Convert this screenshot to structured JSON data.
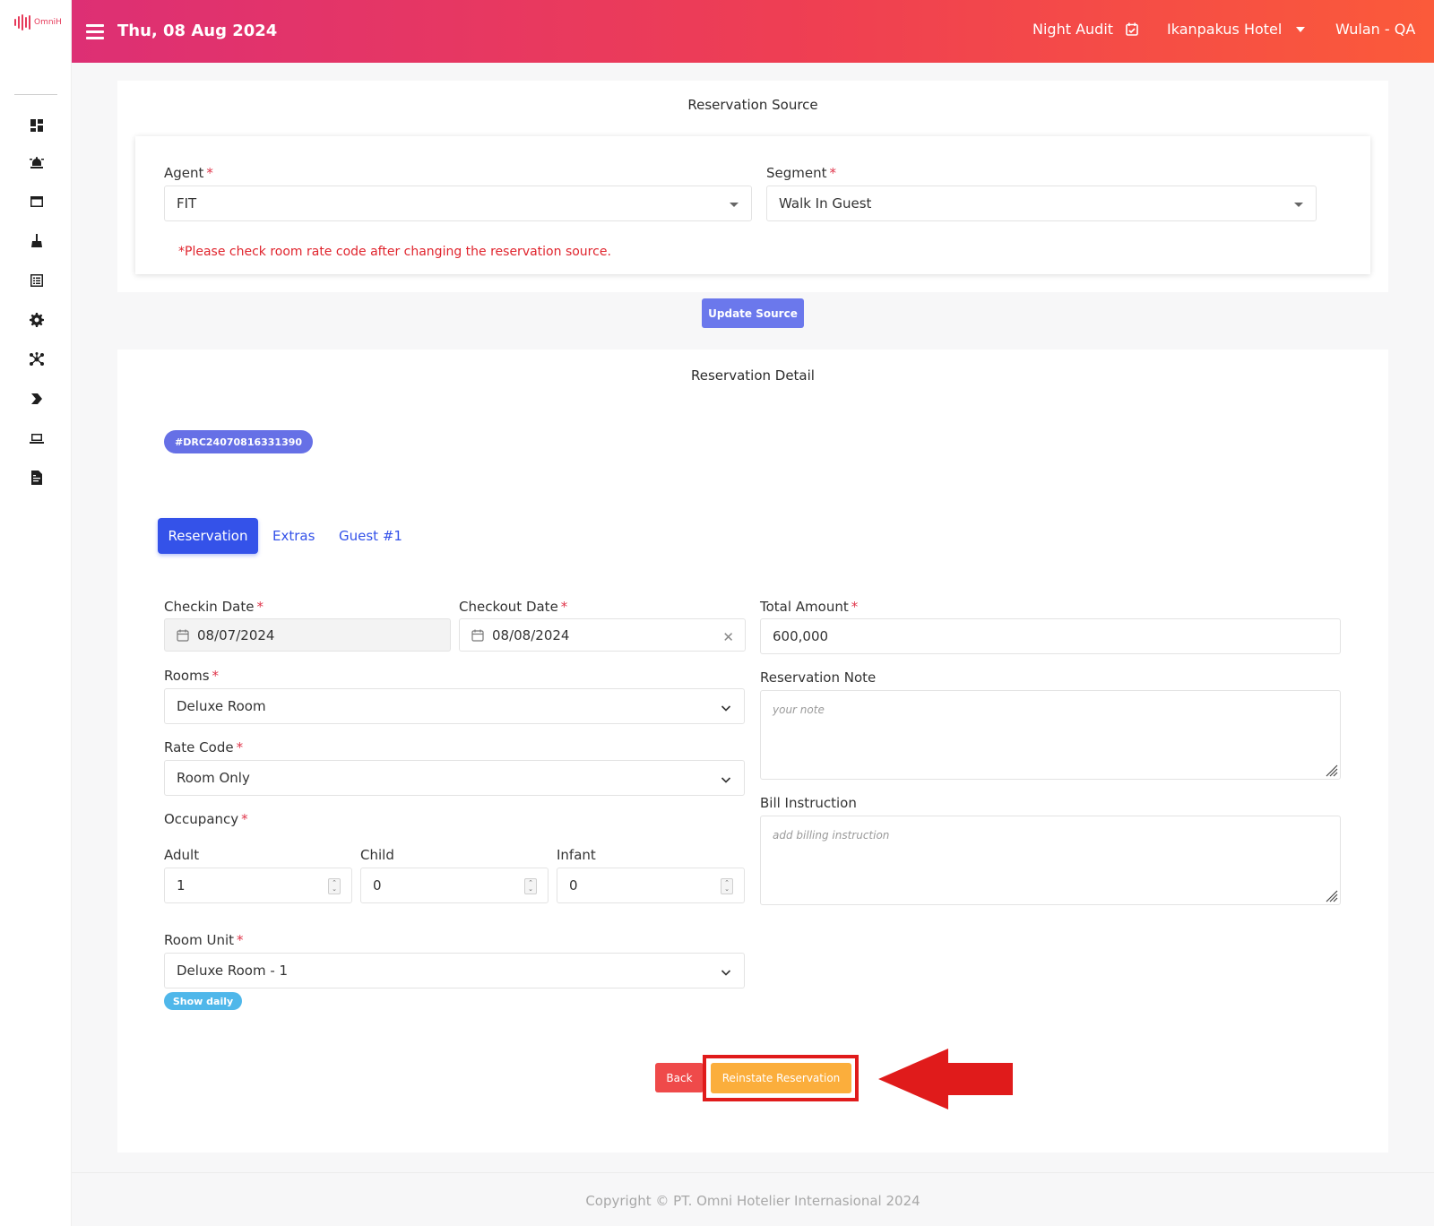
{
  "brand": {
    "logo_text": "OmniH",
    "accent": "#dd2f74"
  },
  "header": {
    "date": "Thu, 08 Aug 2024",
    "night_audit": "Night Audit",
    "hotel": "Ikanpakus Hotel",
    "user": "Wulan - QA"
  },
  "sidebar": {
    "icons": [
      "dashboard-icon",
      "concierge-bell-icon",
      "window-icon",
      "broom-icon",
      "list-icon",
      "gear-icon",
      "network-icon",
      "chevron-right-icon",
      "laptop-icon",
      "file-invoice-icon"
    ]
  },
  "source": {
    "title": "Reservation Source",
    "agent_label": "Agent",
    "agent_value": "FIT",
    "segment_label": "Segment",
    "segment_value": "Walk In Guest",
    "warning": "*Please check room rate code after changing the reservation source.",
    "update_button": "Update Source"
  },
  "detail": {
    "title": "Reservation Detail",
    "reservation_id": "#DRC24070816331390",
    "tabs": [
      "Reservation",
      "Extras",
      "Guest #1"
    ],
    "checkin_label": "Checkin Date",
    "checkin_value": "08/07/2024",
    "checkout_label": "Checkout Date",
    "checkout_value": "08/08/2024",
    "total_label": "Total Amount",
    "total_value": "600,000",
    "rooms_label": "Rooms",
    "rooms_value": "Deluxe Room",
    "note_label": "Reservation Note",
    "note_placeholder": "your note",
    "rate_label": "Rate Code",
    "rate_value": "Room Only",
    "bill_label": "Bill Instruction",
    "bill_placeholder": "add billing instruction",
    "occupancy_label": "Occupancy",
    "adult_label": "Adult",
    "adult_value": "1",
    "child_label": "Child",
    "child_value": "0",
    "infant_label": "Infant",
    "infant_value": "0",
    "unit_label": "Room Unit",
    "unit_value": "Deluxe Room - 1",
    "show_daily": "Show daily",
    "back_button": "Back",
    "reinstate_button": "Reinstate Reservation"
  },
  "footer": {
    "copyright": "Copyright © PT. Omni Hotelier Internasional 2024"
  },
  "colors": {
    "primary": "#3452e9",
    "warning_text": "#e0242d",
    "reinstate": "#fbae3c",
    "back": "#ef4a4a",
    "highlight": "#e01b1b"
  }
}
